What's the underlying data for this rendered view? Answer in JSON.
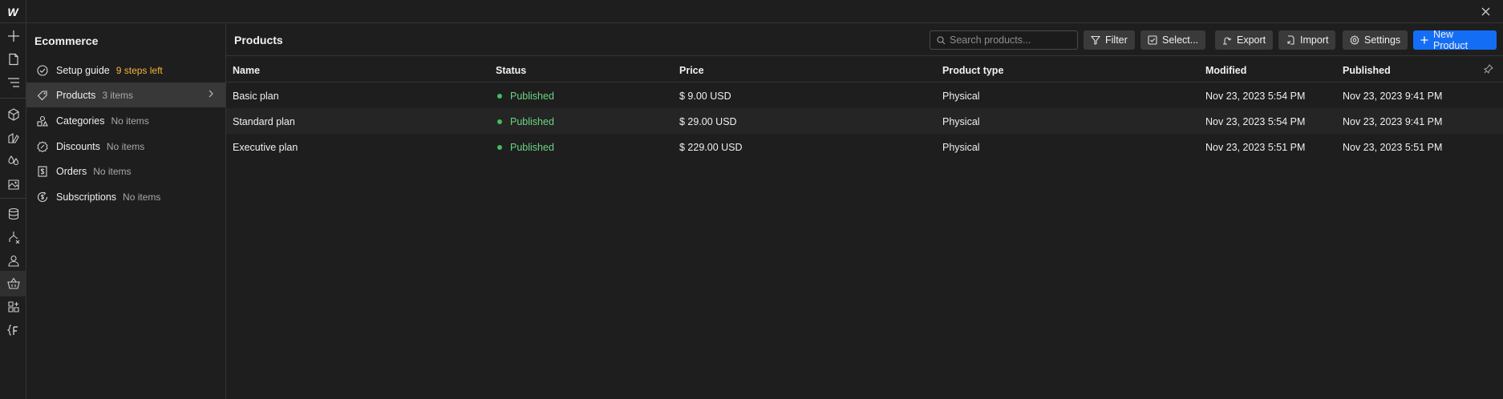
{
  "window": {
    "logo": "W"
  },
  "sidebar": {
    "title": "Ecommerce",
    "items": [
      {
        "label": "Setup guide",
        "meta": "9 steps left",
        "icon": "check-circle-icon"
      },
      {
        "label": "Products",
        "meta": "3 items",
        "icon": "tag-icon"
      },
      {
        "label": "Categories",
        "meta": "No items",
        "icon": "shapes-icon"
      },
      {
        "label": "Discounts",
        "meta": "No items",
        "icon": "discount-badge-icon"
      },
      {
        "label": "Orders",
        "meta": "No items",
        "icon": "receipt-icon"
      },
      {
        "label": "Subscriptions",
        "meta": "No items",
        "icon": "subscription-icon"
      }
    ]
  },
  "main": {
    "title": "Products",
    "search_placeholder": "Search products...",
    "toolbar": {
      "filter": "Filter",
      "select": "Select...",
      "export": "Export",
      "import": "Import",
      "settings": "Settings",
      "new_product": "New Product"
    },
    "columns": [
      "Name",
      "Status",
      "Price",
      "Product type",
      "Modified",
      "Published"
    ],
    "rows": [
      {
        "name": "Basic plan",
        "status": "Published",
        "price": "$ 9.00 USD",
        "type": "Physical",
        "modified": "Nov 23, 2023 5:54 PM",
        "published": "Nov 23, 2023 9:41 PM"
      },
      {
        "name": "Standard plan",
        "status": "Published",
        "price": "$ 29.00 USD",
        "type": "Physical",
        "modified": "Nov 23, 2023 5:54 PM",
        "published": "Nov 23, 2023 9:41 PM"
      },
      {
        "name": "Executive plan",
        "status": "Published",
        "price": "$ 229.00 USD",
        "type": "Physical",
        "modified": "Nov 23, 2023 5:51 PM",
        "published": "Nov 23, 2023 5:51 PM"
      }
    ]
  },
  "colors": {
    "accent": "#146ef5",
    "published": "#6bd481",
    "warning": "#f5b43a"
  }
}
